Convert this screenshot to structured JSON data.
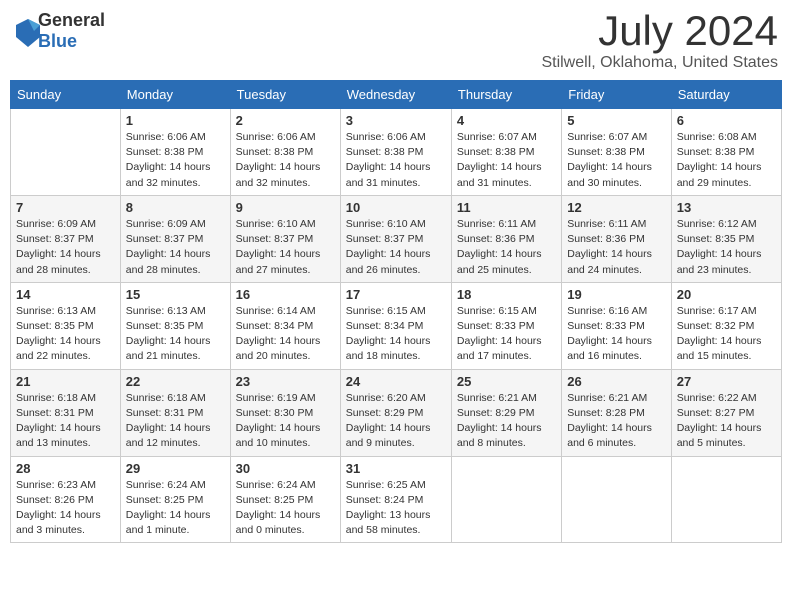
{
  "logo": {
    "general": "General",
    "blue": "Blue"
  },
  "title": "July 2024",
  "location": "Stilwell, Oklahoma, United States",
  "days_of_week": [
    "Sunday",
    "Monday",
    "Tuesday",
    "Wednesday",
    "Thursday",
    "Friday",
    "Saturday"
  ],
  "weeks": [
    [
      {
        "day": "",
        "sunrise": "",
        "sunset": "",
        "daylight": ""
      },
      {
        "day": "1",
        "sunrise": "Sunrise: 6:06 AM",
        "sunset": "Sunset: 8:38 PM",
        "daylight": "Daylight: 14 hours and 32 minutes."
      },
      {
        "day": "2",
        "sunrise": "Sunrise: 6:06 AM",
        "sunset": "Sunset: 8:38 PM",
        "daylight": "Daylight: 14 hours and 32 minutes."
      },
      {
        "day": "3",
        "sunrise": "Sunrise: 6:06 AM",
        "sunset": "Sunset: 8:38 PM",
        "daylight": "Daylight: 14 hours and 31 minutes."
      },
      {
        "day": "4",
        "sunrise": "Sunrise: 6:07 AM",
        "sunset": "Sunset: 8:38 PM",
        "daylight": "Daylight: 14 hours and 31 minutes."
      },
      {
        "day": "5",
        "sunrise": "Sunrise: 6:07 AM",
        "sunset": "Sunset: 8:38 PM",
        "daylight": "Daylight: 14 hours and 30 minutes."
      },
      {
        "day": "6",
        "sunrise": "Sunrise: 6:08 AM",
        "sunset": "Sunset: 8:38 PM",
        "daylight": "Daylight: 14 hours and 29 minutes."
      }
    ],
    [
      {
        "day": "7",
        "sunrise": "Sunrise: 6:09 AM",
        "sunset": "Sunset: 8:37 PM",
        "daylight": "Daylight: 14 hours and 28 minutes."
      },
      {
        "day": "8",
        "sunrise": "Sunrise: 6:09 AM",
        "sunset": "Sunset: 8:37 PM",
        "daylight": "Daylight: 14 hours and 28 minutes."
      },
      {
        "day": "9",
        "sunrise": "Sunrise: 6:10 AM",
        "sunset": "Sunset: 8:37 PM",
        "daylight": "Daylight: 14 hours and 27 minutes."
      },
      {
        "day": "10",
        "sunrise": "Sunrise: 6:10 AM",
        "sunset": "Sunset: 8:37 PM",
        "daylight": "Daylight: 14 hours and 26 minutes."
      },
      {
        "day": "11",
        "sunrise": "Sunrise: 6:11 AM",
        "sunset": "Sunset: 8:36 PM",
        "daylight": "Daylight: 14 hours and 25 minutes."
      },
      {
        "day": "12",
        "sunrise": "Sunrise: 6:11 AM",
        "sunset": "Sunset: 8:36 PM",
        "daylight": "Daylight: 14 hours and 24 minutes."
      },
      {
        "day": "13",
        "sunrise": "Sunrise: 6:12 AM",
        "sunset": "Sunset: 8:35 PM",
        "daylight": "Daylight: 14 hours and 23 minutes."
      }
    ],
    [
      {
        "day": "14",
        "sunrise": "Sunrise: 6:13 AM",
        "sunset": "Sunset: 8:35 PM",
        "daylight": "Daylight: 14 hours and 22 minutes."
      },
      {
        "day": "15",
        "sunrise": "Sunrise: 6:13 AM",
        "sunset": "Sunset: 8:35 PM",
        "daylight": "Daylight: 14 hours and 21 minutes."
      },
      {
        "day": "16",
        "sunrise": "Sunrise: 6:14 AM",
        "sunset": "Sunset: 8:34 PM",
        "daylight": "Daylight: 14 hours and 20 minutes."
      },
      {
        "day": "17",
        "sunrise": "Sunrise: 6:15 AM",
        "sunset": "Sunset: 8:34 PM",
        "daylight": "Daylight: 14 hours and 18 minutes."
      },
      {
        "day": "18",
        "sunrise": "Sunrise: 6:15 AM",
        "sunset": "Sunset: 8:33 PM",
        "daylight": "Daylight: 14 hours and 17 minutes."
      },
      {
        "day": "19",
        "sunrise": "Sunrise: 6:16 AM",
        "sunset": "Sunset: 8:33 PM",
        "daylight": "Daylight: 14 hours and 16 minutes."
      },
      {
        "day": "20",
        "sunrise": "Sunrise: 6:17 AM",
        "sunset": "Sunset: 8:32 PM",
        "daylight": "Daylight: 14 hours and 15 minutes."
      }
    ],
    [
      {
        "day": "21",
        "sunrise": "Sunrise: 6:18 AM",
        "sunset": "Sunset: 8:31 PM",
        "daylight": "Daylight: 14 hours and 13 minutes."
      },
      {
        "day": "22",
        "sunrise": "Sunrise: 6:18 AM",
        "sunset": "Sunset: 8:31 PM",
        "daylight": "Daylight: 14 hours and 12 minutes."
      },
      {
        "day": "23",
        "sunrise": "Sunrise: 6:19 AM",
        "sunset": "Sunset: 8:30 PM",
        "daylight": "Daylight: 14 hours and 10 minutes."
      },
      {
        "day": "24",
        "sunrise": "Sunrise: 6:20 AM",
        "sunset": "Sunset: 8:29 PM",
        "daylight": "Daylight: 14 hours and 9 minutes."
      },
      {
        "day": "25",
        "sunrise": "Sunrise: 6:21 AM",
        "sunset": "Sunset: 8:29 PM",
        "daylight": "Daylight: 14 hours and 8 minutes."
      },
      {
        "day": "26",
        "sunrise": "Sunrise: 6:21 AM",
        "sunset": "Sunset: 8:28 PM",
        "daylight": "Daylight: 14 hours and 6 minutes."
      },
      {
        "day": "27",
        "sunrise": "Sunrise: 6:22 AM",
        "sunset": "Sunset: 8:27 PM",
        "daylight": "Daylight: 14 hours and 5 minutes."
      }
    ],
    [
      {
        "day": "28",
        "sunrise": "Sunrise: 6:23 AM",
        "sunset": "Sunset: 8:26 PM",
        "daylight": "Daylight: 14 hours and 3 minutes."
      },
      {
        "day": "29",
        "sunrise": "Sunrise: 6:24 AM",
        "sunset": "Sunset: 8:25 PM",
        "daylight": "Daylight: 14 hours and 1 minute."
      },
      {
        "day": "30",
        "sunrise": "Sunrise: 6:24 AM",
        "sunset": "Sunset: 8:25 PM",
        "daylight": "Daylight: 14 hours and 0 minutes."
      },
      {
        "day": "31",
        "sunrise": "Sunrise: 6:25 AM",
        "sunset": "Sunset: 8:24 PM",
        "daylight": "Daylight: 13 hours and 58 minutes."
      },
      {
        "day": "",
        "sunrise": "",
        "sunset": "",
        "daylight": ""
      },
      {
        "day": "",
        "sunrise": "",
        "sunset": "",
        "daylight": ""
      },
      {
        "day": "",
        "sunrise": "",
        "sunset": "",
        "daylight": ""
      }
    ]
  ]
}
